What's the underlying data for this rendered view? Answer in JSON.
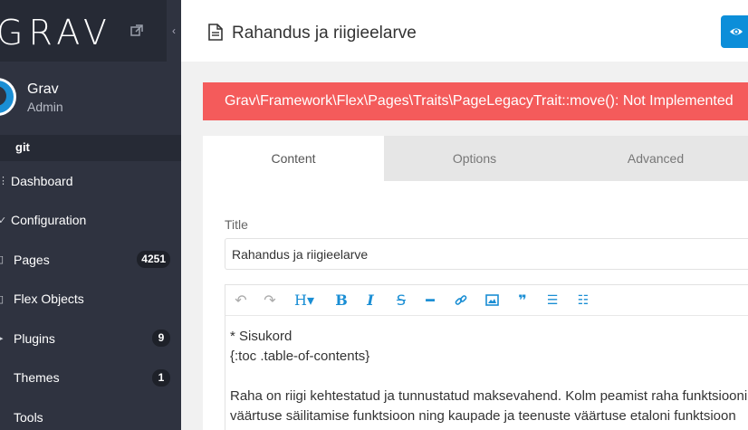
{
  "sidebar": {
    "logo": "GRAV",
    "user": {
      "name": "Grav",
      "role": "Admin"
    },
    "git_label": "git",
    "items": [
      {
        "label": "Dashboard",
        "icon": "dashboard-icon",
        "badge": ""
      },
      {
        "label": "Configuration",
        "icon": "wrench-icon",
        "badge": ""
      },
      {
        "label": "Pages",
        "icon": "file-icon",
        "badge": "4251"
      },
      {
        "label": "Flex Objects",
        "icon": "list-icon",
        "badge": ""
      },
      {
        "label": "Plugins",
        "icon": "plug-icon",
        "badge": "9"
      },
      {
        "label": "Themes",
        "icon": "tint-icon",
        "badge": "1"
      },
      {
        "label": "Tools",
        "icon": "briefcase-icon",
        "badge": ""
      }
    ]
  },
  "header": {
    "title": "Rahandus ja riigieelarve"
  },
  "alert": {
    "message": "Grav\\Framework\\Flex\\Pages\\Traits\\PageLegacyTrait::move(): Not Implemented"
  },
  "tabs": [
    "Content",
    "Options",
    "Advanced"
  ],
  "form": {
    "title_label": "Title",
    "title_value": "Rahandus ja riigieelarve"
  },
  "editor": {
    "toolbar": [
      "undo-icon",
      "redo-icon",
      "heading-icon",
      "bold-icon",
      "italic-icon",
      "strikethrough-icon",
      "horizontal-rule-icon",
      "link-icon",
      "image-icon",
      "quote-icon",
      "bullet-list-icon",
      "numbered-list-icon"
    ],
    "lines": [
      "* Sisukord",
      "{:toc .table-of-contents}",
      "",
      "Raha on riigi kehtestatud ja tunnustatud maksevahend. Kolm peamist raha funktsiooni",
      "väärtuse säilitamise funktsioon ning kaupade ja teenuste väärtuse etaloni funktsioon"
    ]
  },
  "colors": {
    "sidebar": "#2f3340",
    "accent": "#1a8ed4",
    "alert": "#f45b5b"
  }
}
